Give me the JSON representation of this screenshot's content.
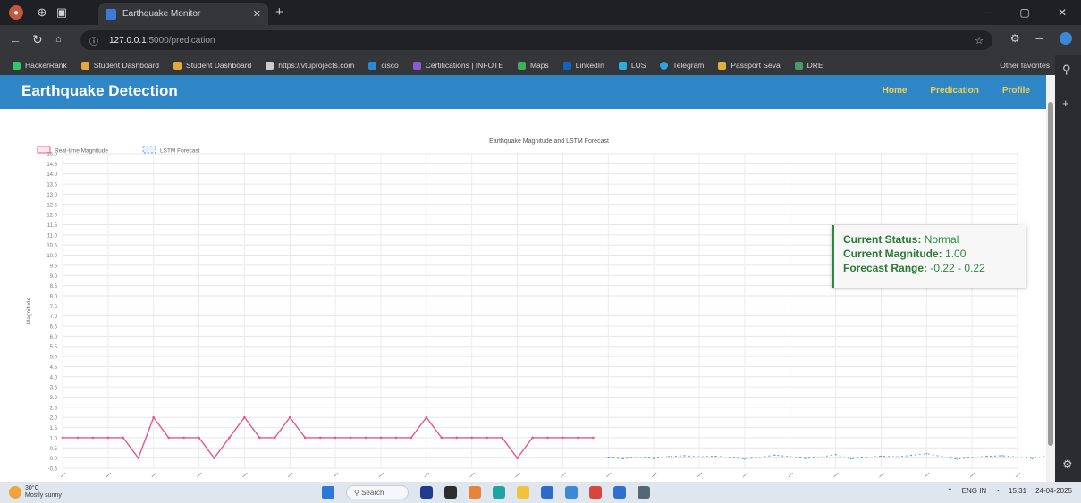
{
  "browser": {
    "tab_title": "Earthquake Monitor",
    "url_host": "127.0.0.1",
    "url_path": ":5000/predication",
    "bookmarks": [
      "HackerRank",
      "Student Dashboard",
      "Student Dashboard",
      "https://vtuprojects.com",
      "cisco",
      "Certifications | INFOTE",
      "Maps",
      "LinkedIn",
      "LUS",
      "Telegram",
      "Passport Seva",
      "DRE"
    ],
    "other_bookmarks": "Other favorites"
  },
  "page": {
    "brand": "Earthquake Detection",
    "nav": [
      "Home",
      "Predication",
      "Profile"
    ]
  },
  "status": {
    "status_label": "Current Status:",
    "status_value": "Normal",
    "magnitude_label": "Current Magnitude:",
    "magnitude_value": "1.00",
    "range_label": "Forecast Range:",
    "range_value": "-0.22 - 0.22",
    "color": "#2a8a3c"
  },
  "chart_data": {
    "type": "line",
    "title": "Earthquake Magnitude and LSTM Forecast",
    "ylabel": "Magnitude",
    "ylim": [
      -0.5,
      15.0
    ],
    "yticks": [
      -0.5,
      0.0,
      0.5,
      1.0,
      1.5,
      2.0,
      2.5,
      3.0,
      3.5,
      4.0,
      4.5,
      5.0,
      5.5,
      6.0,
      6.5,
      7.0,
      7.5,
      8.0,
      8.5,
      9.0,
      9.5,
      10.0,
      10.5,
      11.0,
      11.5,
      12.0,
      12.5,
      13.0,
      13.5,
      14.0,
      14.5,
      15.0
    ],
    "n_points": 64,
    "grid": true,
    "legend_position": "top-left",
    "series": [
      {
        "name": "Real-time Magnitude",
        "color": "#e8578a",
        "start_index": 0,
        "values": [
          1,
          1,
          1,
          1,
          1,
          0,
          2,
          1,
          1,
          1,
          0,
          1,
          2,
          1,
          1,
          2,
          1,
          1,
          1,
          1,
          1,
          1,
          1,
          1,
          2,
          1,
          1,
          1,
          1,
          1,
          0,
          1,
          1,
          1,
          1,
          1
        ]
      },
      {
        "name": "LSTM Forecast",
        "color": "#5aa5e8",
        "dashed": true,
        "start_index": 36,
        "values": [
          0.02,
          -0.03,
          0.05,
          -0.02,
          0.08,
          0.12,
          0.06,
          0.1,
          0.03,
          -0.05,
          0.04,
          0.15,
          0.07,
          -0.02,
          0.05,
          0.18,
          -0.04,
          0.02,
          0.1,
          0.06,
          0.14,
          0.22,
          0.08,
          -0.05,
          0.03,
          0.09,
          0.12,
          0.05,
          -0.02,
          0.1,
          0.04,
          0.0
        ]
      }
    ]
  },
  "taskbar": {
    "weather_temp": "30°C",
    "weather_desc": "Mostly sunny",
    "search": "Search",
    "lang": "ENG IN",
    "time": "15:31",
    "date": "24-04-2025"
  }
}
